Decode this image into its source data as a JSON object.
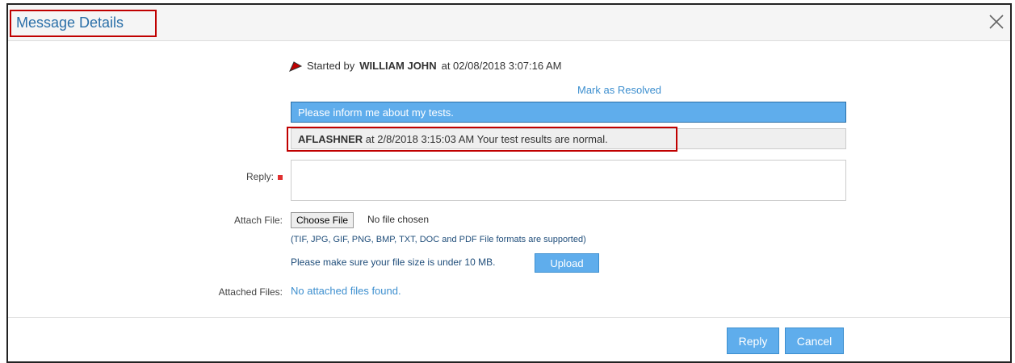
{
  "dialog": {
    "title": "Message Details",
    "close_icon": "close-icon"
  },
  "thread": {
    "started_prefix": "Started by",
    "started_by": "WILLIAM JOHN",
    "started_at": "at 02/08/2018 3:07:16 AM",
    "mark_resolved": "Mark as Resolved",
    "original_message": "Please inform me about my tests.",
    "reply_author": "AFLASHNER",
    "reply_text": "at 2/8/2018 3:15:03 AM Your test results are normal."
  },
  "form": {
    "reply_label": "Reply:",
    "reply_value": "",
    "attach_label": "Attach File:",
    "choose_file": "Choose File",
    "no_file": "No file chosen",
    "formats_note": "(TIF, JPG, GIF, PNG, BMP, TXT, DOC and PDF File formats are supported)",
    "size_note": "Please make sure your file size is under 10 MB.",
    "upload": "Upload",
    "attached_label": "Attached Files:",
    "attached_value": "No attached files found."
  },
  "footer": {
    "reply": "Reply",
    "cancel": "Cancel"
  },
  "colors": {
    "accent": "#5fadec",
    "title": "#2a6fa8",
    "highlight": "#c00000"
  }
}
